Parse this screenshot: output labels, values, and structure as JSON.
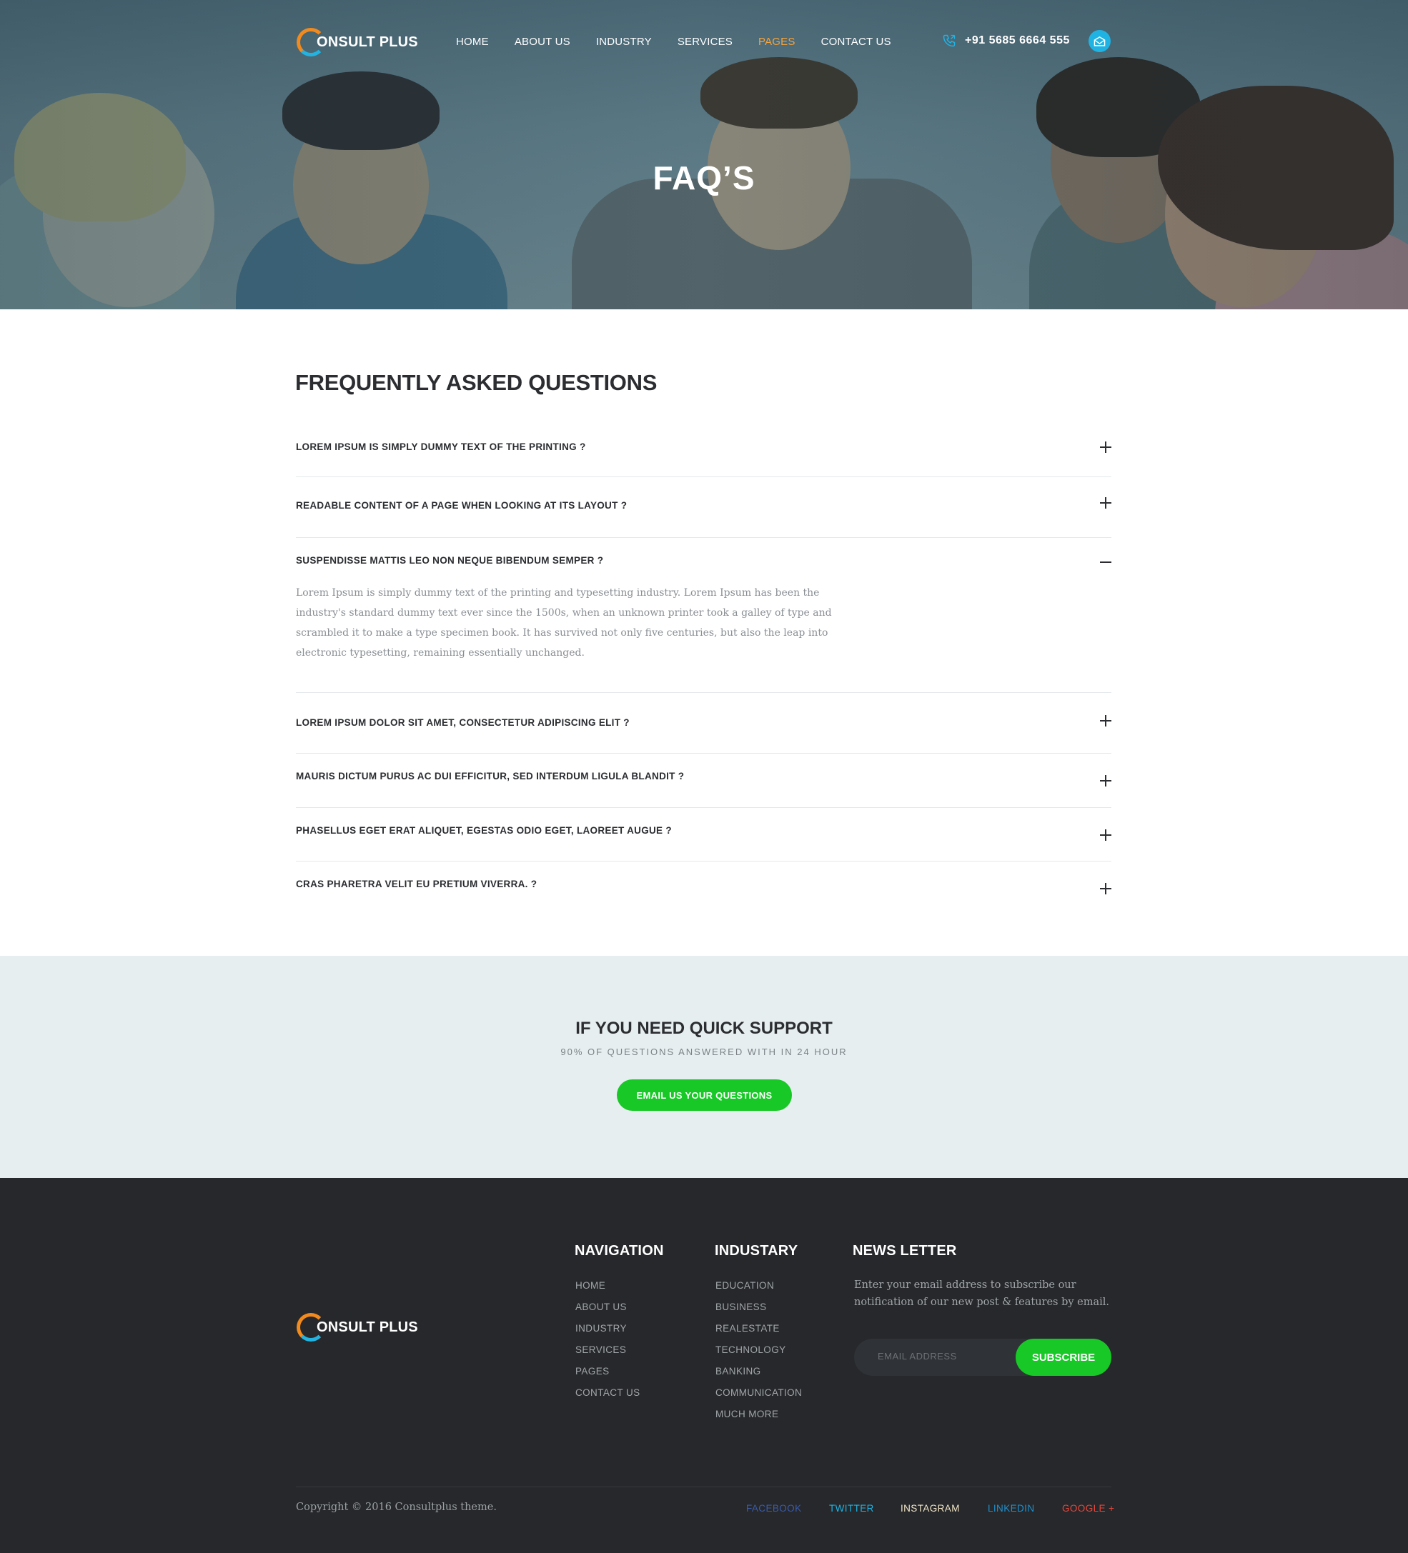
{
  "header": {
    "brand": "ONSULT PLUS",
    "nav": [
      {
        "label": "HOME",
        "active": false
      },
      {
        "label": "ABOUT US",
        "active": false
      },
      {
        "label": "INDUSTRY",
        "active": false
      },
      {
        "label": "SERVICES",
        "active": false
      },
      {
        "label": "PAGES",
        "active": true
      },
      {
        "label": "CONTACT US",
        "active": false
      }
    ],
    "phone": "+91 5685 6664 555",
    "icons": {
      "phone": "phone-icon",
      "mail": "mail-icon"
    }
  },
  "hero": {
    "title": "FAQ’S"
  },
  "faq": {
    "title": "FREQUENTLY ASKED QUESTIONS",
    "items": [
      {
        "question": "LOREM IPSUM IS SIMPLY DUMMY TEXT OF THE PRINTING ?",
        "expanded": false
      },
      {
        "question": "READABLE CONTENT OF A PAGE WHEN LOOKING AT ITS LAYOUT ?",
        "expanded": false
      },
      {
        "question": "SUSPENDISSE MATTIS LEO NON NEQUE BIBENDUM SEMPER ?",
        "expanded": true,
        "answer": "Lorem Ipsum is simply dummy text of the printing and typesetting industry. Lorem Ipsum has been the industry's standard dummy text ever since the 1500s, when an unknown printer took a galley of type and scrambled it to make a type specimen book. It has survived not only five centuries, but also the leap into electronic typesetting, remaining essentially unchanged."
      },
      {
        "question": "LOREM IPSUM DOLOR SIT AMET, CONSECTETUR ADIPISCING ELIT ?",
        "expanded": false
      },
      {
        "question": "MAURIS DICTUM PURUS AC DUI EFFICITUR, SED INTERDUM LIGULA BLANDIT ?",
        "expanded": false
      },
      {
        "question": "PHASELLUS EGET ERAT ALIQUET, EGESTAS ODIO EGET, LAOREET AUGUE ?",
        "expanded": false
      },
      {
        "question": "CRAS PHARETRA VELIT EU PRETIUM VIVERRA. ?",
        "expanded": false
      }
    ]
  },
  "support": {
    "title": "IF YOU NEED QUICK SUPPORT",
    "subtitle": "90% OF QUESTIONS ANSWERED WITH IN 24 HOUR",
    "button": "EMAIL US YOUR QUESTIONS"
  },
  "footer": {
    "brand": "ONSULT PLUS",
    "navigation": {
      "title": "NAVIGATION",
      "links": [
        "HOME",
        "ABOUT US",
        "INDUSTRY",
        "SERVICES",
        "PAGES",
        "CONTACT US"
      ]
    },
    "industry": {
      "title": "INDUSTARY",
      "links": [
        "EDUCATION",
        "BUSINESS",
        "REALESTATE",
        "TECHNOLOGY",
        "BANKING",
        "COMMUNICATION",
        "MUCH MORE"
      ]
    },
    "newsletter": {
      "title": "NEWS LETTER",
      "text": "Enter your email address to subscribe our notification of our new post & features by email.",
      "placeholder": "EMAIL ADDRESS",
      "button": "SUBSCRIBE"
    },
    "copyright": "Copyright © 2016 Consultplus theme.",
    "social": [
      {
        "label": "FACEBOOK",
        "color": "#3b5ba8"
      },
      {
        "label": "TWITTER",
        "color": "#1fb3e4"
      },
      {
        "label": "INSTAGRAM",
        "color": "#f3e6c8"
      },
      {
        "label": "LINKEDIN",
        "color": "#1f8fce"
      },
      {
        "label": "GOOGLE +",
        "color": "#e8463a"
      }
    ]
  },
  "colors": {
    "accent_green": "#17c826",
    "accent_blue": "#1fb3e4",
    "active_nav": "#f6a33b",
    "footer_bg": "#26282b"
  }
}
